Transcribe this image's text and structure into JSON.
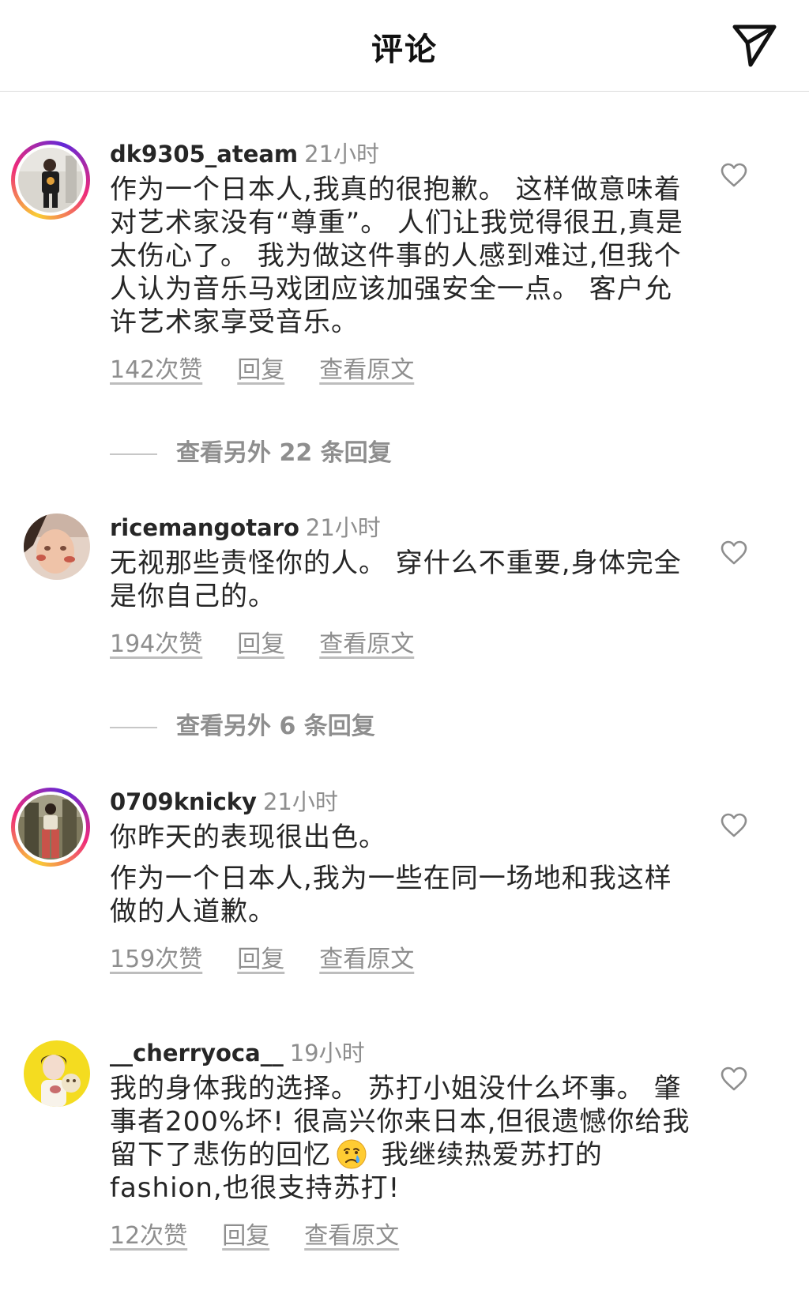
{
  "header": {
    "title": "评论",
    "send_icon": "send-icon"
  },
  "comments": [
    {
      "username": "dk9305_ateam",
      "time": "21小时",
      "lines": [
        "作为一个日本人,我真的很抱歉。 这样做意味着对艺术家没有“尊重”。 人们让我觉得很丑,真是太伤心了。 我为做这件事的人感到难过,但我个人认为音乐马戏团应该加强安全一点。 客户允许艺术家享受音乐。"
      ],
      "likes": "142次赞",
      "reply": "回复",
      "see_original": "查看原文"
    },
    {
      "username": "ricemangotaro",
      "time": "21小时",
      "lines": [
        "无视那些责怪你的人。 穿什么不重要,身体完全是你自己的。"
      ],
      "likes": "194次赞",
      "reply": "回复",
      "see_original": "查看原文"
    },
    {
      "username": "0709knicky",
      "time": "21小时",
      "lines": [
        "你昨天的表现很出色。",
        "作为一个日本人,我为一些在同一场地和我这样做的人道歉。"
      ],
      "likes": "159次赞",
      "reply": "回复",
      "see_original": "查看原文"
    },
    {
      "username": "__cherryoca__",
      "time": "19小时",
      "text_before_emoji": "我的身体我的选择。 苏打小姐没什么坏事。 肇事者200%坏! 很高兴你来日本,但很遗憾你给我留下了悲伤的回忆",
      "emoji": "crying-face-emoji",
      "text_after_emoji": " 我继续热爱苏打的fashion,也很支持苏打!",
      "likes": "12次赞",
      "reply": "回复",
      "see_original": "查看原文"
    }
  ],
  "more_replies": [
    "查看另外 22 条回复",
    "查看另外 6 条回复"
  ],
  "colors": {
    "text": "#262626",
    "secondary": "#8e8e8e",
    "story_ring_start": "#f9ce34",
    "story_ring_mid": "#ee2a7b"
  }
}
